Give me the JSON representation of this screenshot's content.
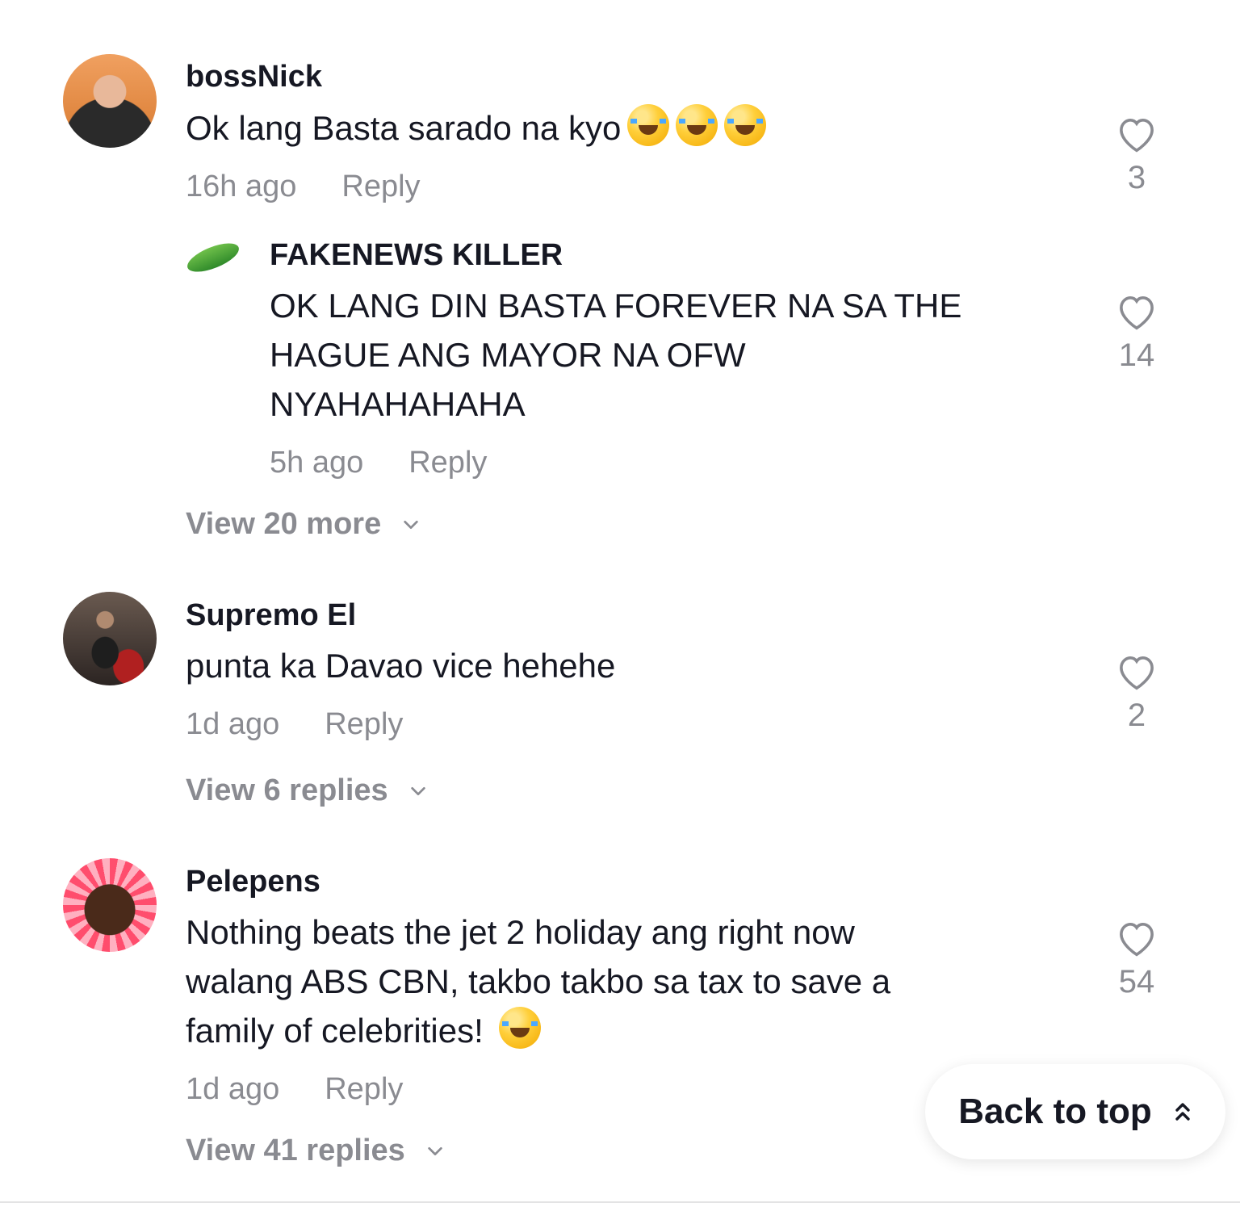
{
  "comments": [
    {
      "username": "bossNick",
      "text": "Ok lang Basta sarado na kyo",
      "emoji": "rolling-on-floor-laughing x3",
      "time": "16h ago",
      "reply_label": "Reply",
      "likes": "3",
      "view_more": "View 20 more",
      "replies": [
        {
          "username": "FAKENEWS KILLER",
          "text_lines": [
            "OK LANG DIN BASTA FOREVER NA SA THE",
            "HAGUE ANG MAYOR NA OFW",
            "NYAHAHAHAHA"
          ],
          "time": "5h ago",
          "reply_label": "Reply",
          "likes": "14"
        }
      ]
    },
    {
      "username": "Supremo El",
      "text": "punta ka Davao vice hehehe",
      "time": "1d ago",
      "reply_label": "Reply",
      "likes": "2",
      "view_more": "View 6 replies"
    },
    {
      "username": "Pelepens",
      "text_lines": [
        "Nothing beats the jet 2 holiday ang right now",
        "walang ABS CBN, takbo takbo sa tax to save a",
        "family of celebrities!"
      ],
      "emoji": "face-with-tears-of-joy",
      "time": "1d ago",
      "reply_label": "Reply",
      "likes": "54",
      "view_more": "View 41 replies"
    }
  ],
  "back_to_top": "Back to top",
  "icons": {
    "like": "heart-outline-icon",
    "expand": "chevron-down-icon",
    "back_to_top": "double-chevron-up-icon"
  }
}
